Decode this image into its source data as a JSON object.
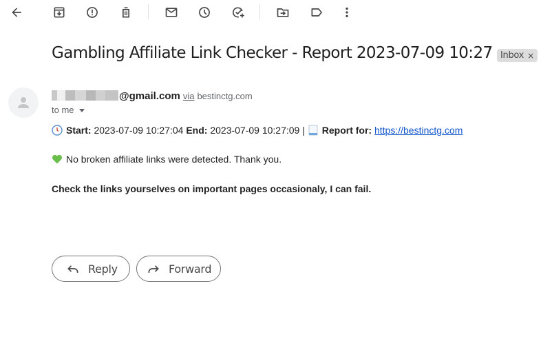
{
  "toolbar": {
    "items": [
      {
        "name": "back",
        "icon": "arrow-left-icon",
        "label": "Back"
      },
      {
        "name": "archive",
        "icon": "archive-icon",
        "label": "Archive"
      },
      {
        "name": "report-spam",
        "icon": "report-spam-icon",
        "label": "Report spam"
      },
      {
        "name": "delete",
        "icon": "trash-icon",
        "label": "Delete"
      },
      {
        "name": "mark-unread",
        "icon": "mail-icon",
        "label": "Mark as unread"
      },
      {
        "name": "snooze",
        "icon": "clock-icon",
        "label": "Snooze"
      },
      {
        "name": "add-to-tasks",
        "icon": "add-task-icon",
        "label": "Add to Tasks"
      },
      {
        "name": "move-to",
        "icon": "move-folder-icon",
        "label": "Move to"
      },
      {
        "name": "labels",
        "icon": "label-icon",
        "label": "Labels"
      },
      {
        "name": "more",
        "icon": "more-vert-icon",
        "label": "More"
      }
    ]
  },
  "email": {
    "subject": "Gambling Affiliate Link Checker - Report 2023-07-09 10:27",
    "label": {
      "text": "Inbox",
      "remove": "×"
    },
    "sender": {
      "address_visible": "@gmail.com",
      "via_text": "via",
      "via_domain": "bestinctg.com"
    },
    "recipient_text": "to me",
    "body": {
      "start_label": "Start:",
      "start_value": "2023-07-09 10:27:04",
      "end_label": "End:",
      "end_value": "2023-07-09 10:27:09",
      "separator": "|",
      "report_label": "Report for:",
      "report_link": "https://bestinctg.com",
      "status_message": "No broken affiliate links were detected. Thank you.",
      "warning": "Check the links yourselves on important pages occasionaly, I can fail."
    },
    "emoji": {
      "clock": "clock-emoji",
      "page": "page-emoji",
      "heart": "green-heart-emoji"
    }
  },
  "actions": {
    "reply": "Reply",
    "forward": "Forward"
  },
  "colors": {
    "link": "#1155cc",
    "heart": "#6abf4b",
    "chip_bg": "#dddddd"
  }
}
